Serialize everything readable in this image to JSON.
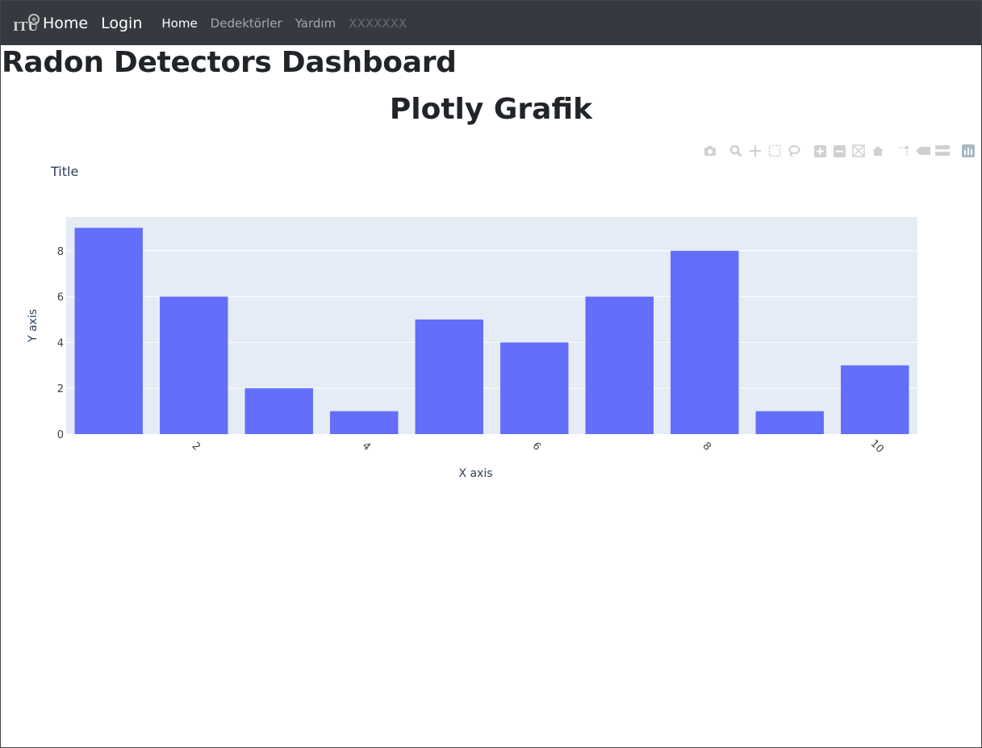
{
  "navbar": {
    "brand_home": "Home",
    "login": "Login",
    "links": [
      {
        "label": "Home",
        "state": "active"
      },
      {
        "label": "Dedektörler",
        "state": "normal"
      },
      {
        "label": "Yardım",
        "state": "normal"
      },
      {
        "label": "XXXXXXX",
        "state": "disabled"
      }
    ]
  },
  "page": {
    "title": "Radon Detectors Dashboard",
    "graph_heading": "Plotly Grafik"
  },
  "modebar": {
    "icons": [
      "camera-icon",
      "zoom-icon",
      "pan-icon",
      "box-select-icon",
      "lasso-icon",
      "zoom-in-icon",
      "zoom-out-icon",
      "autoscale-icon",
      "reset-axes-icon",
      "spike-lines-icon",
      "hover-closest-icon",
      "hover-compare-icon",
      "plotly-logo-icon"
    ]
  },
  "colors": {
    "navbar_bg": "#343a40",
    "bar": "#636efa",
    "plot_bg": "#e5ecf6"
  },
  "chart_data": {
    "type": "bar",
    "title": "Title",
    "xlabel": "X axis",
    "ylabel": "Y axis",
    "x": [
      1,
      2,
      3,
      4,
      5,
      6,
      7,
      8,
      9,
      10
    ],
    "values": [
      9,
      6,
      2,
      1,
      5,
      4,
      6,
      8,
      1,
      3
    ],
    "x_ticks": [
      2,
      4,
      6,
      8,
      10
    ],
    "y_ticks": [
      0,
      2,
      4,
      6,
      8
    ],
    "xlim": [
      0.5,
      10.5
    ],
    "ylim": [
      0,
      9.47
    ],
    "grid": true,
    "x_tick_rotation": 45
  }
}
